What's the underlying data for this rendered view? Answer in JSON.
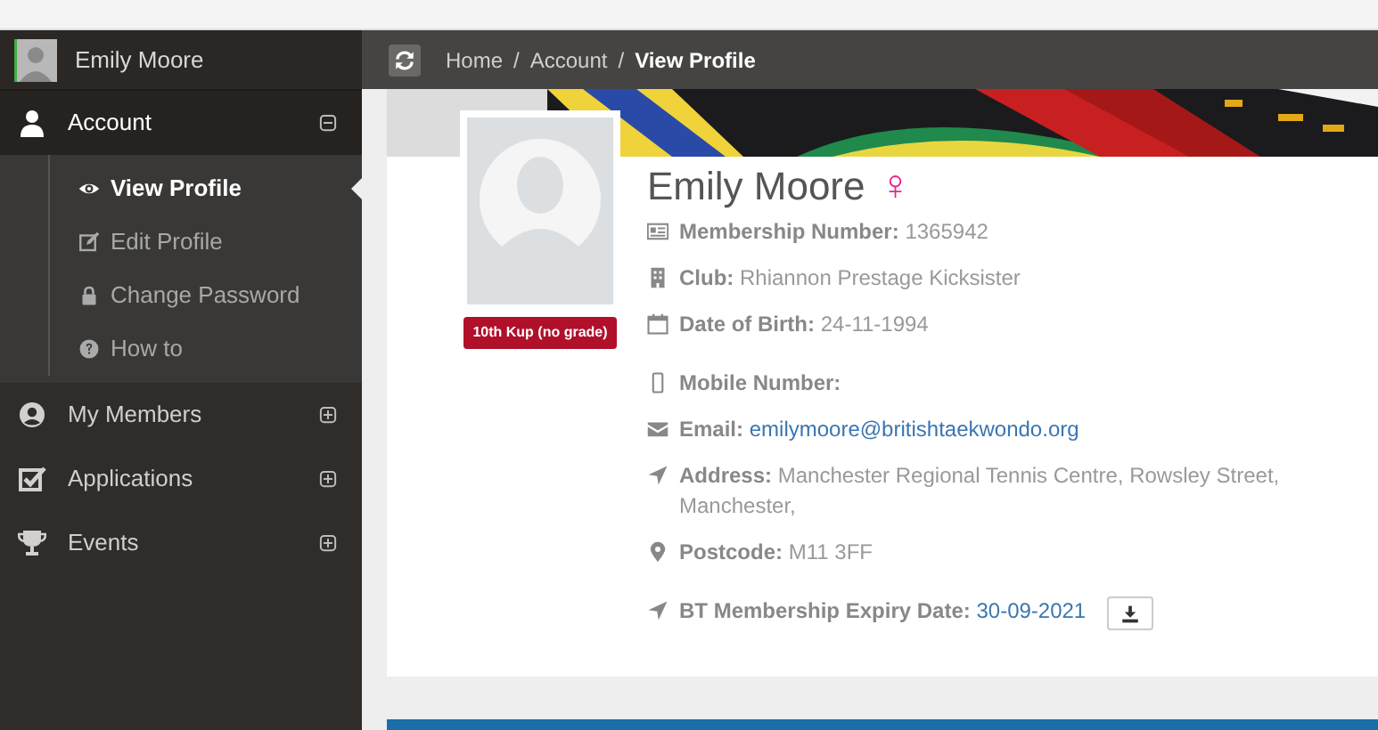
{
  "sidebar": {
    "user": {
      "name": "Emily Moore"
    },
    "items": [
      {
        "label": "Account",
        "expanded": true,
        "children": [
          {
            "label": "View Profile",
            "selected": true
          },
          {
            "label": "Edit Profile",
            "selected": false
          },
          {
            "label": "Change Password",
            "selected": false
          },
          {
            "label": "How to",
            "selected": false
          }
        ]
      },
      {
        "label": "My Members",
        "expanded": false
      },
      {
        "label": "Applications",
        "expanded": false
      },
      {
        "label": "Events",
        "expanded": false
      }
    ]
  },
  "breadcrumb": [
    {
      "label": "Home",
      "current": false,
      "separator": "/"
    },
    {
      "label": "Account",
      "current": false,
      "separator": "/"
    },
    {
      "label": "View Profile",
      "current": true
    }
  ],
  "profile": {
    "name": "Emily Moore",
    "gender_symbol": "♀",
    "grade": "10th Kup (no grade)",
    "field_groups": [
      [
        {
          "label": "Membership Number:",
          "value": "1365942",
          "link": false
        },
        {
          "label": "Club:",
          "value": "Rhiannon Prestage Kicksister",
          "link": false
        },
        {
          "label": "Date of Birth:",
          "value": "24-11-1994",
          "link": false
        }
      ],
      [
        {
          "label": "Mobile Number:"
        },
        {
          "label": "Email:",
          "value": "emilymoore@britishtaekwondo.org",
          "link": true
        },
        {
          "label": "Address:",
          "value": "Manchester Regional Tennis Centre, Rowsley Street, Manchester,",
          "link": false
        },
        {
          "label": "Postcode:",
          "value": "M11 3FF",
          "link": false
        }
      ],
      [
        {
          "label": "BT Membership Expiry Date:",
          "value": "30-09-2021",
          "link": true,
          "kind": "download"
        }
      ]
    ]
  }
}
